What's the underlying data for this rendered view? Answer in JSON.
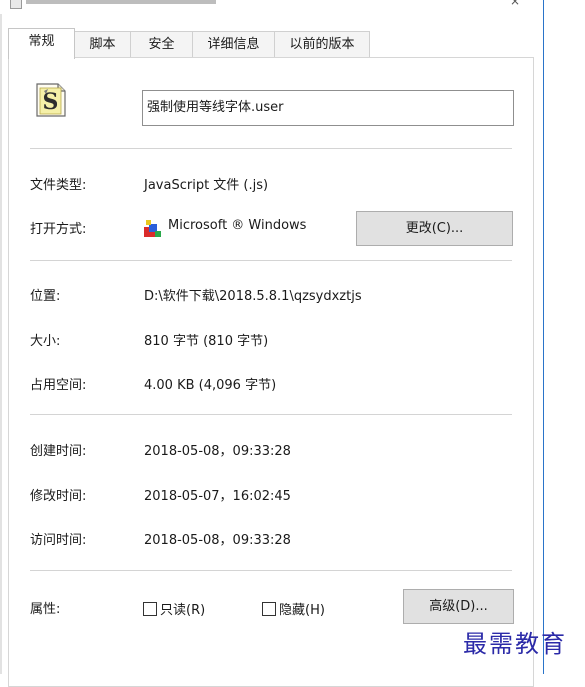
{
  "tabs": [
    "常规",
    "脚本",
    "安全",
    "详细信息",
    "以前的版本"
  ],
  "file_name": "强制使用等线字体.user",
  "rows": {
    "type_label": "文件类型:",
    "type_value": "JavaScript 文件 (.js)",
    "open_label": "打开方式:",
    "open_value": "Microsoft ® Windows",
    "change_button": "更改(C)...",
    "location_label": "位置:",
    "location_value": "D:\\软件下载\\2018.5.8.1\\qzsydxztjs",
    "size_label": "大小:",
    "size_value": "810 字节 (810 字节)",
    "disk_label": "占用空间:",
    "disk_value": "4.00 KB (4,096 字节)",
    "created_label": "创建时间:",
    "created_value": "2018-05-08，09:33:28",
    "modified_label": "修改时间:",
    "modified_value": "2018-05-07，16:02:45",
    "accessed_label": "访问时间:",
    "accessed_value": "2018-05-08，09:33:28",
    "attr_label": "属性:",
    "readonly_label": "只读(R)",
    "readonly_checked": false,
    "hidden_label": "隐藏(H)",
    "hidden_checked": false,
    "advanced_button": "高级(D)..."
  },
  "watermark": "最需教育",
  "icons": {
    "file": "js-script-file-icon",
    "open_with": "windows-script-host-icon",
    "title": "window-title-icon",
    "close": "close-icon"
  }
}
